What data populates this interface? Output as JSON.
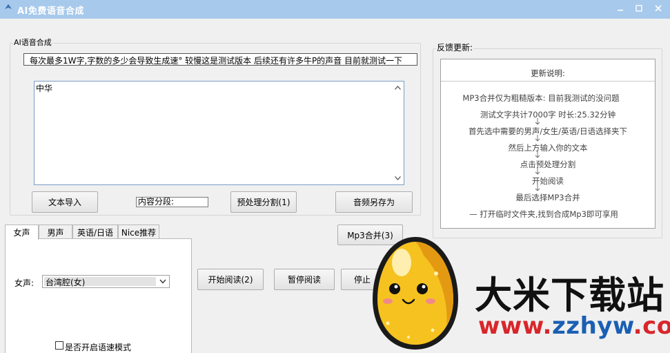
{
  "window": {
    "title": "AI免费语音合成"
  },
  "ai_group": {
    "legend": "AI语音合成",
    "notice": "每次最多1W字,字数的多少会导致生成速° 较慢这是测试版本    后续还有许多牛P的声音 目前就测试一下",
    "text_content": "中华",
    "buttons": {
      "import": "文本导入",
      "segment_label": "内容分段:",
      "preprocess": "预处理分割(1)",
      "save_audio": "音频另存为"
    }
  },
  "feedback": {
    "legend": "反馈更新:",
    "heading": "更新说明:",
    "lines": [
      "MP3合并仅为粗糙版本: 目前我测试的没问题",
      "测试文字共计7000字 时长:25.32分钟",
      "首先选中需要的男声/女生/英语/日语选择夹下",
      "然后上方输入你的文本",
      "点击预处理分割",
      "开始阅读",
      "最后选择MP3合并",
      "—    打开临时文件夹,找到合成Mp3即可享用"
    ]
  },
  "tabs": {
    "items": [
      {
        "label": "女声"
      },
      {
        "label": "男声"
      },
      {
        "label": "英语/日语"
      },
      {
        "label": "Nice推荐"
      }
    ],
    "active_index": 0,
    "voice_label": "女声:",
    "voice_selected": "台湾腔(女)",
    "speed_mode_label": "是否开启语速模式",
    "speed_mode_checked": false
  },
  "controls": {
    "mp3_merge": "Mp3合并(3)",
    "start_reading": "开始阅读(2)",
    "pause_reading": "暂停阅读",
    "stop_reading": "停止"
  },
  "watermark": {
    "site_name": "大米下载站",
    "url_part1": "www.",
    "url_part2": "zzhyw",
    "url_part3": ".com"
  },
  "colors": {
    "titlebar": "#a6c9ec",
    "url_red": "#d8262b",
    "url_blue": "#1a5fb4",
    "egg_yellow": "#f6c21f"
  }
}
